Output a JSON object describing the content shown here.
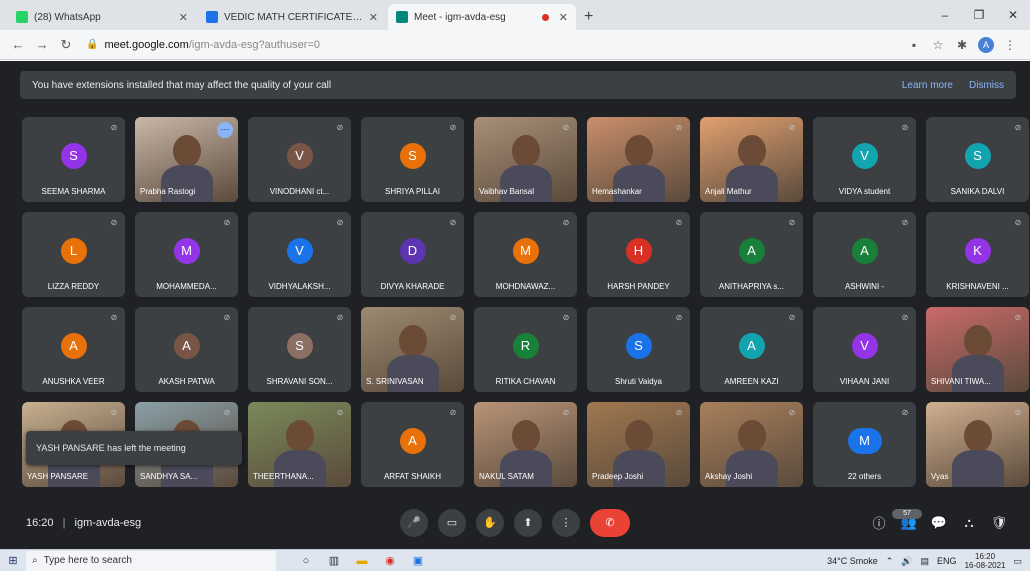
{
  "browser": {
    "tabs": [
      {
        "label": "(28) WhatsApp",
        "favicon_color": "#25d366",
        "active": false
      },
      {
        "label": "VEDIC MATH CERTIFICATE COU",
        "favicon_color": "#1a73e8",
        "active": false
      },
      {
        "label": "Meet - igm-avda-esg",
        "favicon_color": "#00897b",
        "active": true
      }
    ],
    "new_tab": "+",
    "window_controls": [
      "–",
      "❐",
      "✕"
    ],
    "url_host": "meet.google.com",
    "url_path": "/igm-avda-esg?authuser=0"
  },
  "banner": {
    "text": "You have extensions installed that may affect the quality of your call",
    "learn_more": "Learn more",
    "dismiss": "Dismiss"
  },
  "participants": [
    {
      "name": "SEEMA SHARMA",
      "initial": "S",
      "color": "#9334e6",
      "video": false
    },
    {
      "name": "Prabha Rastogi",
      "initial": "",
      "color": "#c9b8a8",
      "video": true,
      "highlight": true
    },
    {
      "name": "VINODHANI ct...",
      "initial": "V",
      "color": "#795548",
      "video": false
    },
    {
      "name": "SHRIYA PILLAI",
      "initial": "S",
      "color": "#e8710a",
      "video": false
    },
    {
      "name": "Vaibhav Bansal",
      "initial": "",
      "color": "#a89078",
      "video": true
    },
    {
      "name": "Hemashankar",
      "initial": "",
      "color": "#c98e6a",
      "video": true
    },
    {
      "name": "Anjali Mathur",
      "initial": "",
      "color": "#e0a070",
      "video": true
    },
    {
      "name": "VIDYA student",
      "initial": "V",
      "color": "#12a4af",
      "video": false
    },
    {
      "name": "SANIKA DALVI",
      "initial": "S",
      "color": "#12a4af",
      "video": false
    },
    {
      "name": "LIZZA REDDY",
      "initial": "L",
      "color": "#e8710a",
      "video": false
    },
    {
      "name": "MOHAMMEDA...",
      "initial": "M",
      "color": "#9334e6",
      "video": false
    },
    {
      "name": "VIDHYALAKSH...",
      "initial": "V",
      "color": "#1a73e8",
      "video": false
    },
    {
      "name": "DIVYA KHARADE",
      "initial": "D",
      "color": "#5e35b1",
      "video": false
    },
    {
      "name": "MOHDNAWAZ...",
      "initial": "M",
      "color": "#e8710a",
      "video": false
    },
    {
      "name": "HARSH PANDEY",
      "initial": "H",
      "color": "#d93025",
      "video": false
    },
    {
      "name": "ANITHAPRIYA s...",
      "initial": "A",
      "color": "#188038",
      "video": false
    },
    {
      "name": "ASHWINI -",
      "initial": "A",
      "color": "#188038",
      "video": false
    },
    {
      "name": "KRISHNAVENI ...",
      "initial": "K",
      "color": "#9334e6",
      "video": false
    },
    {
      "name": "ANUSHKA VEER",
      "initial": "A",
      "color": "#e8710a",
      "video": false
    },
    {
      "name": "AKASH PATWA",
      "initial": "A",
      "color": "#795548",
      "video": false
    },
    {
      "name": "SHRAVANI SON...",
      "initial": "S",
      "color": "#8d6e63",
      "video": false
    },
    {
      "name": "S. SRINIVASAN",
      "initial": "",
      "color": "#9c8a70",
      "video": true
    },
    {
      "name": "RITIKA CHAVAN",
      "initial": "R",
      "color": "#188038",
      "video": false
    },
    {
      "name": "Shruti Vaidya",
      "initial": "S",
      "color": "#1a73e8",
      "video": false
    },
    {
      "name": "AMREEN KAZI",
      "initial": "A",
      "color": "#12a4af",
      "video": false
    },
    {
      "name": "VIHAAN JANI",
      "initial": "V",
      "color": "#9334e6",
      "video": false
    },
    {
      "name": "SHIVANI TIWA...",
      "initial": "",
      "color": "#c96a6a",
      "video": true
    },
    {
      "name": "YASH PANSARE",
      "initial": "",
      "color": "#c8b090",
      "video": true
    },
    {
      "name": "SANDHYA SA...",
      "initial": "",
      "color": "#8aa0a8",
      "video": true
    },
    {
      "name": "THEERTHANA...",
      "initial": "",
      "color": "#7a8a5a",
      "video": true
    },
    {
      "name": "ARFAT SHAIKH",
      "initial": "A",
      "color": "#e8710a",
      "video": false
    },
    {
      "name": "NAKUL SATAM",
      "initial": "",
      "color": "#b89478",
      "video": true
    },
    {
      "name": "Pradeep Joshi",
      "initial": "",
      "color": "#a07850",
      "video": true
    },
    {
      "name": "Akshay Joshi",
      "initial": "",
      "color": "#a8805c",
      "video": true
    },
    {
      "name": "22 others",
      "initial": "M",
      "color": "#1a73e8",
      "video": false,
      "others": true
    },
    {
      "name": "Vyas",
      "initial": "",
      "color": "#d0b090",
      "video": true
    }
  ],
  "toast": "YASH PANSARE has left the meeting",
  "meeting": {
    "time": "16:20",
    "separator": "|",
    "code": "igm-avda-esg"
  },
  "controls": {
    "mic": "🎤",
    "camera": "▭",
    "raise_hand": "✋",
    "present": "⬆",
    "more": "⋮",
    "end": "✆"
  },
  "right_controls": {
    "info": "ⓘ",
    "people": "👥",
    "people_count": "57",
    "chat": "💬",
    "activities": "⛬",
    "host": "🛡"
  },
  "taskbar": {
    "search_placeholder": "Type here to search",
    "weather": "34°C Smoke",
    "lang": "ENG",
    "time": "16:20",
    "date": "16-08-2021"
  },
  "colors": {
    "meet_bg": "#202124",
    "tile_bg": "#3c4043",
    "end_call": "#ea4335",
    "accent": "#8ab4f8"
  }
}
